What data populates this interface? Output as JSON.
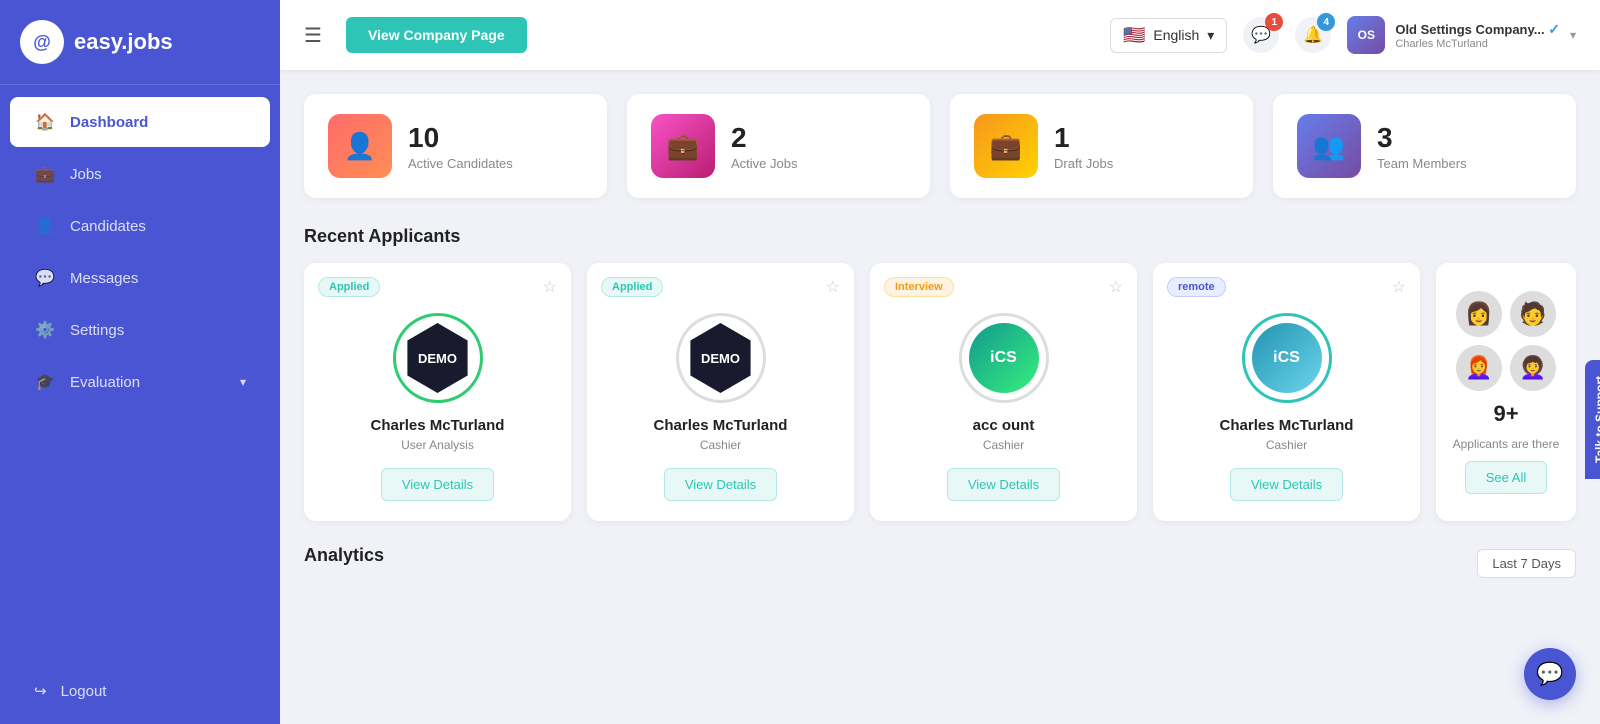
{
  "brand": {
    "logo_text": "@",
    "app_name": "easy.jobs"
  },
  "sidebar": {
    "items": [
      {
        "id": "dashboard",
        "label": "Dashboard",
        "icon": "🏠",
        "active": true
      },
      {
        "id": "jobs",
        "label": "Jobs",
        "icon": "💼",
        "active": false
      },
      {
        "id": "candidates",
        "label": "Candidates",
        "icon": "👤",
        "active": false
      },
      {
        "id": "messages",
        "label": "Messages",
        "icon": "💬",
        "active": false
      },
      {
        "id": "settings",
        "label": "Settings",
        "icon": "⚙️",
        "active": false
      },
      {
        "id": "evaluation",
        "label": "Evaluation",
        "icon": "🎓",
        "active": false
      }
    ],
    "logout_label": "Logout",
    "logout_icon": "🚪"
  },
  "header": {
    "view_company_btn": "View Company Page",
    "language": {
      "selected": "English",
      "flag": "🇺🇸"
    },
    "notifications_count": "1",
    "bell_count": "4",
    "company": {
      "name": "Old Settings Company...",
      "user": "Charles McTurland",
      "verified": true
    }
  },
  "stats": [
    {
      "id": "active-candidates",
      "count": "10",
      "label": "Active Candidates",
      "icon": "👤",
      "color": "red"
    },
    {
      "id": "active-jobs",
      "count": "2",
      "label": "Active Jobs",
      "icon": "💼",
      "color": "pink"
    },
    {
      "id": "draft-jobs",
      "count": "1",
      "label": "Draft Jobs",
      "icon": "📋",
      "color": "orange"
    },
    {
      "id": "team-members",
      "count": "3",
      "label": "Team Members",
      "icon": "👥",
      "color": "blue"
    }
  ],
  "recent_applicants": {
    "section_title": "Recent Applicants",
    "cards": [
      {
        "id": "card-1",
        "badge": "Applied",
        "badge_type": "applied",
        "name": "Charles McTurland",
        "role": "User Analysis",
        "logo_type": "demo",
        "ring": "green",
        "view_btn": "View Details"
      },
      {
        "id": "card-2",
        "badge": "Applied",
        "badge_type": "applied",
        "name": "Charles McTurland",
        "role": "Cashier",
        "logo_type": "demo",
        "ring": "none",
        "view_btn": "View Details"
      },
      {
        "id": "card-3",
        "badge": "Interview",
        "badge_type": "interview",
        "name": "acc ount",
        "role": "Cashier",
        "logo_type": "ics",
        "ring": "none",
        "view_btn": "View Details"
      },
      {
        "id": "card-4",
        "badge": "remote",
        "badge_type": "remote",
        "name": "Charles McTurland",
        "role": "Cashier",
        "logo_type": "ics-blue",
        "ring": "teal",
        "view_btn": "View Details"
      }
    ],
    "more": {
      "count": "9+",
      "label": "Applicants are there",
      "see_all_btn": "See All"
    }
  },
  "analytics": {
    "title": "Analytics",
    "period_btn": "Last 7 Days"
  },
  "support": {
    "label": "Talk to Support"
  },
  "chat_fab": "💬"
}
